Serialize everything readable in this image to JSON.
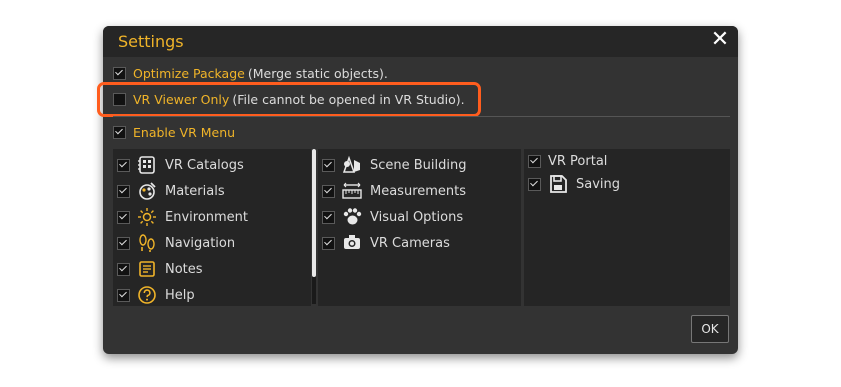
{
  "dialog": {
    "title": "Settings",
    "close_label": "✕"
  },
  "options": {
    "optimize": {
      "label": "Optimize Package",
      "note": "(Merge static objects).",
      "checked": true
    },
    "viewer": {
      "label": "VR Viewer Only",
      "note": "(File cannot be opened in VR Studio).",
      "checked": false
    },
    "vr_menu": {
      "label": "Enable VR Menu",
      "checked": true
    }
  },
  "menu": {
    "col1": [
      {
        "label": "VR Catalogs",
        "icon": "catalog-icon",
        "checked": true
      },
      {
        "label": "Materials",
        "icon": "materials-icon",
        "checked": true
      },
      {
        "label": "Environment",
        "icon": "sun-icon",
        "checked": true
      },
      {
        "label": "Navigation",
        "icon": "footprints-icon",
        "checked": true
      },
      {
        "label": "Notes",
        "icon": "notes-icon",
        "checked": true
      },
      {
        "label": "Help",
        "icon": "help-icon",
        "checked": true
      }
    ],
    "col2": [
      {
        "label": "Scene Building",
        "icon": "shapes-icon",
        "checked": true
      },
      {
        "label": "Measurements",
        "icon": "ruler-icon",
        "checked": true
      },
      {
        "label": "Visual Options",
        "icon": "paw-icon",
        "checked": true
      },
      {
        "label": "VR Cameras",
        "icon": "camera-icon",
        "checked": true
      }
    ],
    "col3": [
      {
        "label": "VR Portal",
        "icon": "",
        "checked": true
      },
      {
        "label": "Saving",
        "icon": "save-icon",
        "checked": true
      }
    ]
  },
  "footer": {
    "ok_label": "OK"
  },
  "colors": {
    "accent": "#f0b429",
    "highlight": "#ff5d1e",
    "dialog_bg": "#333333"
  }
}
